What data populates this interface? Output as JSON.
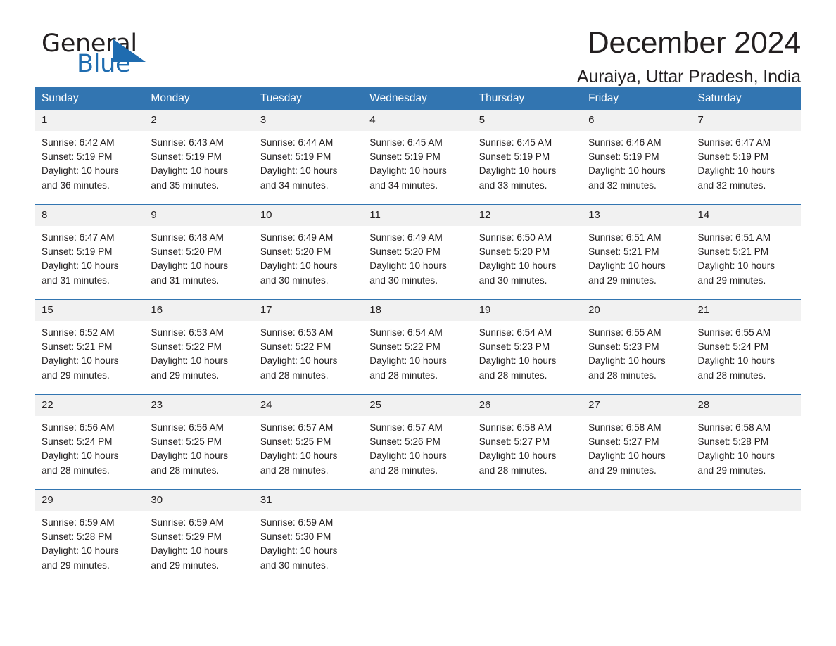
{
  "brand": {
    "name_part1": "General",
    "name_part2": "Blue",
    "logo_icon": "triangle-icon",
    "accent_color": "#1f6cb0",
    "header_color": "#3275b1"
  },
  "header": {
    "title": "December 2024",
    "subtitle": "Auraiya, Uttar Pradesh, India"
  },
  "calendar": {
    "weekday_headers": [
      "Sunday",
      "Monday",
      "Tuesday",
      "Wednesday",
      "Thursday",
      "Friday",
      "Saturday"
    ],
    "weeks": [
      [
        {
          "day": "1",
          "sunrise": "Sunrise: 6:42 AM",
          "sunset": "Sunset: 5:19 PM",
          "daylight_line1": "Daylight: 10 hours",
          "daylight_line2": "and 36 minutes."
        },
        {
          "day": "2",
          "sunrise": "Sunrise: 6:43 AM",
          "sunset": "Sunset: 5:19 PM",
          "daylight_line1": "Daylight: 10 hours",
          "daylight_line2": "and 35 minutes."
        },
        {
          "day": "3",
          "sunrise": "Sunrise: 6:44 AM",
          "sunset": "Sunset: 5:19 PM",
          "daylight_line1": "Daylight: 10 hours",
          "daylight_line2": "and 34 minutes."
        },
        {
          "day": "4",
          "sunrise": "Sunrise: 6:45 AM",
          "sunset": "Sunset: 5:19 PM",
          "daylight_line1": "Daylight: 10 hours",
          "daylight_line2": "and 34 minutes."
        },
        {
          "day": "5",
          "sunrise": "Sunrise: 6:45 AM",
          "sunset": "Sunset: 5:19 PM",
          "daylight_line1": "Daylight: 10 hours",
          "daylight_line2": "and 33 minutes."
        },
        {
          "day": "6",
          "sunrise": "Sunrise: 6:46 AM",
          "sunset": "Sunset: 5:19 PM",
          "daylight_line1": "Daylight: 10 hours",
          "daylight_line2": "and 32 minutes."
        },
        {
          "day": "7",
          "sunrise": "Sunrise: 6:47 AM",
          "sunset": "Sunset: 5:19 PM",
          "daylight_line1": "Daylight: 10 hours",
          "daylight_line2": "and 32 minutes."
        }
      ],
      [
        {
          "day": "8",
          "sunrise": "Sunrise: 6:47 AM",
          "sunset": "Sunset: 5:19 PM",
          "daylight_line1": "Daylight: 10 hours",
          "daylight_line2": "and 31 minutes."
        },
        {
          "day": "9",
          "sunrise": "Sunrise: 6:48 AM",
          "sunset": "Sunset: 5:20 PM",
          "daylight_line1": "Daylight: 10 hours",
          "daylight_line2": "and 31 minutes."
        },
        {
          "day": "10",
          "sunrise": "Sunrise: 6:49 AM",
          "sunset": "Sunset: 5:20 PM",
          "daylight_line1": "Daylight: 10 hours",
          "daylight_line2": "and 30 minutes."
        },
        {
          "day": "11",
          "sunrise": "Sunrise: 6:49 AM",
          "sunset": "Sunset: 5:20 PM",
          "daylight_line1": "Daylight: 10 hours",
          "daylight_line2": "and 30 minutes."
        },
        {
          "day": "12",
          "sunrise": "Sunrise: 6:50 AM",
          "sunset": "Sunset: 5:20 PM",
          "daylight_line1": "Daylight: 10 hours",
          "daylight_line2": "and 30 minutes."
        },
        {
          "day": "13",
          "sunrise": "Sunrise: 6:51 AM",
          "sunset": "Sunset: 5:21 PM",
          "daylight_line1": "Daylight: 10 hours",
          "daylight_line2": "and 29 minutes."
        },
        {
          "day": "14",
          "sunrise": "Sunrise: 6:51 AM",
          "sunset": "Sunset: 5:21 PM",
          "daylight_line1": "Daylight: 10 hours",
          "daylight_line2": "and 29 minutes."
        }
      ],
      [
        {
          "day": "15",
          "sunrise": "Sunrise: 6:52 AM",
          "sunset": "Sunset: 5:21 PM",
          "daylight_line1": "Daylight: 10 hours",
          "daylight_line2": "and 29 minutes."
        },
        {
          "day": "16",
          "sunrise": "Sunrise: 6:53 AM",
          "sunset": "Sunset: 5:22 PM",
          "daylight_line1": "Daylight: 10 hours",
          "daylight_line2": "and 29 minutes."
        },
        {
          "day": "17",
          "sunrise": "Sunrise: 6:53 AM",
          "sunset": "Sunset: 5:22 PM",
          "daylight_line1": "Daylight: 10 hours",
          "daylight_line2": "and 28 minutes."
        },
        {
          "day": "18",
          "sunrise": "Sunrise: 6:54 AM",
          "sunset": "Sunset: 5:22 PM",
          "daylight_line1": "Daylight: 10 hours",
          "daylight_line2": "and 28 minutes."
        },
        {
          "day": "19",
          "sunrise": "Sunrise: 6:54 AM",
          "sunset": "Sunset: 5:23 PM",
          "daylight_line1": "Daylight: 10 hours",
          "daylight_line2": "and 28 minutes."
        },
        {
          "day": "20",
          "sunrise": "Sunrise: 6:55 AM",
          "sunset": "Sunset: 5:23 PM",
          "daylight_line1": "Daylight: 10 hours",
          "daylight_line2": "and 28 minutes."
        },
        {
          "day": "21",
          "sunrise": "Sunrise: 6:55 AM",
          "sunset": "Sunset: 5:24 PM",
          "daylight_line1": "Daylight: 10 hours",
          "daylight_line2": "and 28 minutes."
        }
      ],
      [
        {
          "day": "22",
          "sunrise": "Sunrise: 6:56 AM",
          "sunset": "Sunset: 5:24 PM",
          "daylight_line1": "Daylight: 10 hours",
          "daylight_line2": "and 28 minutes."
        },
        {
          "day": "23",
          "sunrise": "Sunrise: 6:56 AM",
          "sunset": "Sunset: 5:25 PM",
          "daylight_line1": "Daylight: 10 hours",
          "daylight_line2": "and 28 minutes."
        },
        {
          "day": "24",
          "sunrise": "Sunrise: 6:57 AM",
          "sunset": "Sunset: 5:25 PM",
          "daylight_line1": "Daylight: 10 hours",
          "daylight_line2": "and 28 minutes."
        },
        {
          "day": "25",
          "sunrise": "Sunrise: 6:57 AM",
          "sunset": "Sunset: 5:26 PM",
          "daylight_line1": "Daylight: 10 hours",
          "daylight_line2": "and 28 minutes."
        },
        {
          "day": "26",
          "sunrise": "Sunrise: 6:58 AM",
          "sunset": "Sunset: 5:27 PM",
          "daylight_line1": "Daylight: 10 hours",
          "daylight_line2": "and 28 minutes."
        },
        {
          "day": "27",
          "sunrise": "Sunrise: 6:58 AM",
          "sunset": "Sunset: 5:27 PM",
          "daylight_line1": "Daylight: 10 hours",
          "daylight_line2": "and 29 minutes."
        },
        {
          "day": "28",
          "sunrise": "Sunrise: 6:58 AM",
          "sunset": "Sunset: 5:28 PM",
          "daylight_line1": "Daylight: 10 hours",
          "daylight_line2": "and 29 minutes."
        }
      ],
      [
        {
          "day": "29",
          "sunrise": "Sunrise: 6:59 AM",
          "sunset": "Sunset: 5:28 PM",
          "daylight_line1": "Daylight: 10 hours",
          "daylight_line2": "and 29 minutes."
        },
        {
          "day": "30",
          "sunrise": "Sunrise: 6:59 AM",
          "sunset": "Sunset: 5:29 PM",
          "daylight_line1": "Daylight: 10 hours",
          "daylight_line2": "and 29 minutes."
        },
        {
          "day": "31",
          "sunrise": "Sunrise: 6:59 AM",
          "sunset": "Sunset: 5:30 PM",
          "daylight_line1": "Daylight: 10 hours",
          "daylight_line2": "and 30 minutes."
        },
        {
          "day": "",
          "sunrise": "",
          "sunset": "",
          "daylight_line1": "",
          "daylight_line2": ""
        },
        {
          "day": "",
          "sunrise": "",
          "sunset": "",
          "daylight_line1": "",
          "daylight_line2": ""
        },
        {
          "day": "",
          "sunrise": "",
          "sunset": "",
          "daylight_line1": "",
          "daylight_line2": ""
        },
        {
          "day": "",
          "sunrise": "",
          "sunset": "",
          "daylight_line1": "",
          "daylight_line2": ""
        }
      ]
    ]
  }
}
